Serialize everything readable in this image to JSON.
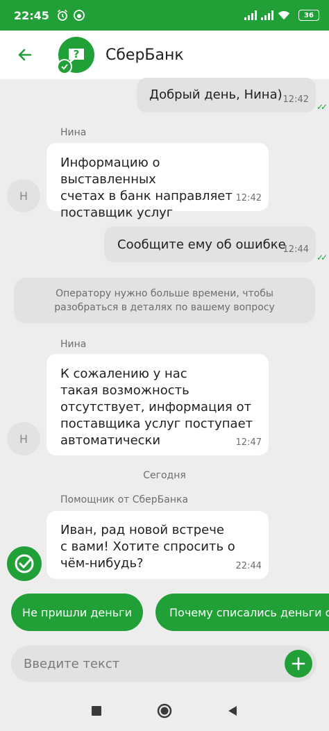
{
  "status_bar": {
    "time": "22:45",
    "battery": "36",
    "icons": [
      "alarm-icon",
      "app-notification-icon",
      "signal-icon",
      "wifi-icon",
      "battery-icon"
    ]
  },
  "header": {
    "title": "СберБанк",
    "back_icon": "arrow-left-icon"
  },
  "messages": [
    {
      "type": "outgoing",
      "text": "Добрый день, Нина)",
      "time": "12:42",
      "read": true
    },
    {
      "type": "incoming",
      "sender": "Нина",
      "avatar": "Н",
      "text": "Информацию о выставленных\nсчетах в банк направляет\nпоставщик услуг",
      "time": "12:42"
    },
    {
      "type": "outgoing",
      "text": "Сообщите ему об ошибке",
      "time": "12:44",
      "read": true
    },
    {
      "type": "system",
      "text": "Оператору нужно больше времени, чтобы разобраться в деталях по вашему вопросу"
    },
    {
      "type": "incoming",
      "sender": "Нина",
      "avatar": "Н",
      "text": "К сожалению у нас\nтакая возможность\nотсутствует,  информация от\nпоставщика услуг поступает\nавтоматически",
      "time": "12:47"
    },
    {
      "type": "date",
      "text": "Сегодня"
    },
    {
      "type": "incoming-bot",
      "sender": "Помощник от СберБанка",
      "text": "Иван, рад новой встрече\nс вами! Хотите спросить о\nчём-нибудь?",
      "time": "22:44"
    }
  ],
  "quick_replies": [
    "Не пришли деньги",
    "Почему списались деньги с"
  ],
  "composer": {
    "placeholder": "Введите текст",
    "add_icon": "plus-icon"
  },
  "nav_bar": [
    "square-recents-icon",
    "circle-home-icon",
    "triangle-back-icon"
  ],
  "colors": {
    "brand": "#21a038",
    "background": "#ededed",
    "incoming_bubble": "#ffffff",
    "outgoing_bubble": "#e2e2e2"
  }
}
